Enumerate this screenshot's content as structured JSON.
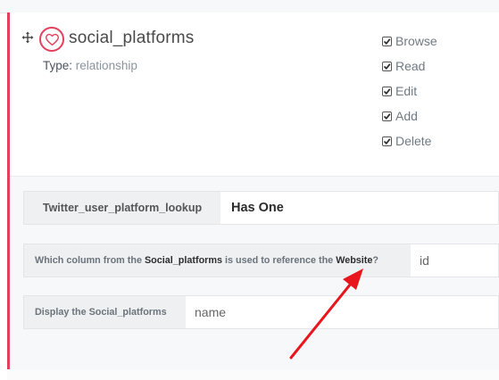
{
  "relationship": {
    "name": "social_platforms",
    "type_label": "Type:",
    "type_value": "relationship",
    "icon": "heart-icon",
    "accent_color": "#e2405c"
  },
  "permissions": [
    {
      "label": "Browse",
      "checked": true
    },
    {
      "label": "Read",
      "checked": true
    },
    {
      "label": "Edit",
      "checked": true
    },
    {
      "label": "Add",
      "checked": true
    },
    {
      "label": "Delete",
      "checked": true
    }
  ],
  "details": {
    "relation_name": "Twitter_user_platform_lookup",
    "relation_type": "Has One",
    "reference": {
      "q_prefix": "Which column from the ",
      "q_table": "Social_platforms",
      "q_middle": " is used to reference the ",
      "q_target": "Website",
      "q_suffix": "?",
      "value": "id"
    },
    "display": {
      "label": "Display the Social_platforms",
      "value": "name"
    }
  },
  "annotation": {
    "color": "#e8161c"
  }
}
